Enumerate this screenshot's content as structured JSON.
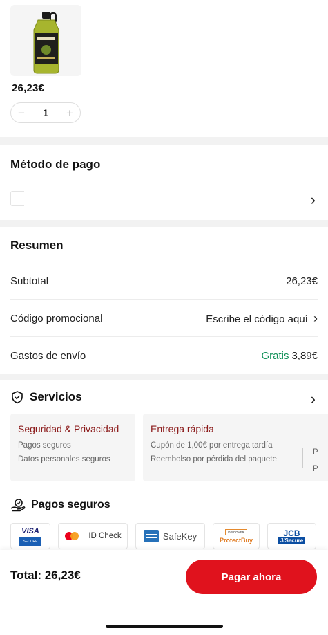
{
  "product": {
    "image_icon": "olive-oil-bottle-icon",
    "price": "26,23€",
    "quantity": "1",
    "minus_glyph": "−",
    "plus_glyph": "+"
  },
  "payment": {
    "title": "Método de pago",
    "chevron": "›"
  },
  "summary": {
    "title": "Resumen",
    "subtotal_label": "Subtotal",
    "subtotal_value": "26,23€",
    "promo_label": "Código promocional",
    "promo_value": "Escribe el código aquí",
    "shipping_label": "Gastos de envío",
    "shipping_free": "Gratis",
    "shipping_old": "3,89€"
  },
  "services": {
    "title": "Servicios",
    "cards": [
      {
        "title": "Seguridad & Privacidad",
        "lines": [
          "Pagos seguros",
          "Datos personales seguros"
        ]
      },
      {
        "title": "Entrega rápida",
        "lines": [
          "Cupón de 1,00€ por entrega tardía",
          "Reembolso por pérdida del paquete"
        ]
      }
    ]
  },
  "secure": {
    "title": "Pagos seguros",
    "badges": [
      "VISA",
      "SECURE",
      "ID Check",
      "SafeKey",
      "DISCOVER",
      "ProtectBuy",
      "JCB",
      "J/Secure"
    ]
  },
  "footer": {
    "total": "Total: 26,23€",
    "pay_label": "Pagar ahora"
  },
  "colors": {
    "accent": "#e0121d",
    "free": "#13925a",
    "service_title": "#8b1a1a"
  }
}
